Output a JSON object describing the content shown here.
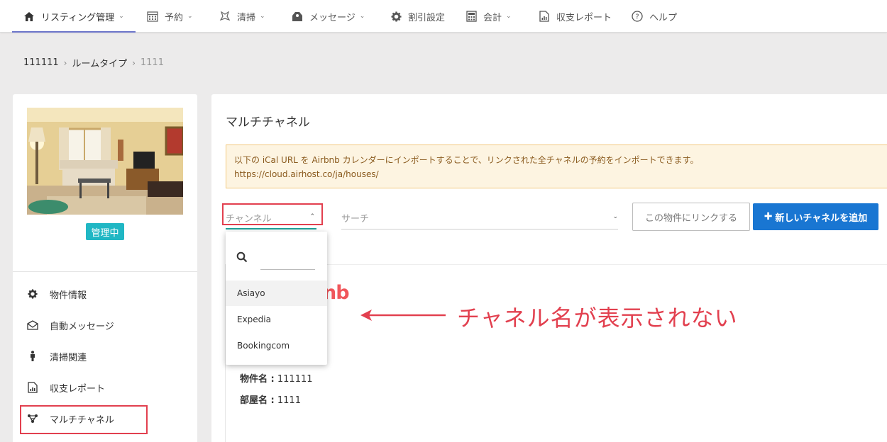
{
  "topnav": {
    "items": [
      {
        "label": "リスティング管理",
        "icon": "home-icon",
        "has_chevron": true,
        "active": true
      },
      {
        "label": "予約",
        "icon": "calendar-icon",
        "has_chevron": true
      },
      {
        "label": "清掃",
        "icon": "cleaning-icon",
        "has_chevron": true
      },
      {
        "label": "メッセージ",
        "icon": "message-icon",
        "has_chevron": true
      },
      {
        "label": "割引設定",
        "icon": "gear-icon",
        "has_chevron": false
      },
      {
        "label": "会計",
        "icon": "calculator-icon",
        "has_chevron": true
      },
      {
        "label": "収支レポート",
        "icon": "report-icon",
        "has_chevron": false
      },
      {
        "label": "ヘルプ",
        "icon": "help-icon",
        "has_chevron": false
      }
    ],
    "chevron": "⌄"
  },
  "breadcrumb": {
    "items": [
      "111111",
      "ルームタイプ",
      "1111"
    ],
    "separator": "›"
  },
  "listing": {
    "status": "管理中",
    "status_color": "#20b7c4"
  },
  "sidebar": {
    "items": [
      {
        "label": "物件情報",
        "icon": "gear-icon"
      },
      {
        "label": "自動メッセージ",
        "icon": "envelope-icon"
      },
      {
        "label": "清掃関連",
        "icon": "person-icon"
      },
      {
        "label": "収支レポート",
        "icon": "report-icon"
      },
      {
        "label": "マルチチャネル",
        "icon": "network-icon"
      }
    ]
  },
  "main": {
    "title": "マルチチャネル",
    "notice_line1": "以下の iCal URL を Airbnb カレンダーにインポートすることで、リンクされた全チャネルの予約をインポートできます。",
    "notice_line2": "https://cloud.airhost.co/ja/houses/",
    "channel_placeholder": "チャンネル",
    "channel_chevron": "⌃",
    "search_placeholder": "サーチ",
    "search_chevron": "⌄",
    "link_button": "この物件にリンクする",
    "add_button": "新しいチャネルを追加",
    "add_button_plus": "✚",
    "logo_fragment": "nb",
    "property_name_label": "物件名 :",
    "property_name_value": "111111",
    "room_name_label": "部屋名 :",
    "room_name_value": "1111",
    "accent_color": "#1976d2"
  },
  "dropdown": {
    "search_value": "",
    "options": [
      "Asiayo",
      "Expedia",
      "Bookingcom"
    ]
  },
  "annotation": {
    "text": "チャネル名が表示されない",
    "color": "#e2404f"
  }
}
